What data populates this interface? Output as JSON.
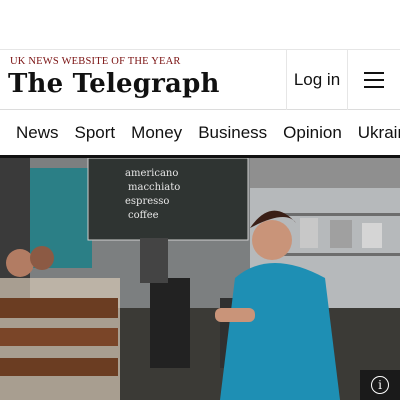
{
  "header": {
    "tagline": "UK NEWS WEBSITE OF THE YEAR",
    "logo_text": "The Telegraph",
    "login_label": "Log in",
    "menu_icon": "hamburger-menu-icon"
  },
  "nav": {
    "items": [
      "News",
      "Sport",
      "Money",
      "Business",
      "Opinion",
      "Ukraine"
    ]
  },
  "hero": {
    "chalkboard_text": [
      "americano",
      "macchiato",
      "espresso",
      "coffee"
    ],
    "info_icon": "info-icon",
    "info_glyph": "i"
  },
  "colors": {
    "tagline": "#7a1111",
    "text": "#111111",
    "rule": "#111111"
  }
}
